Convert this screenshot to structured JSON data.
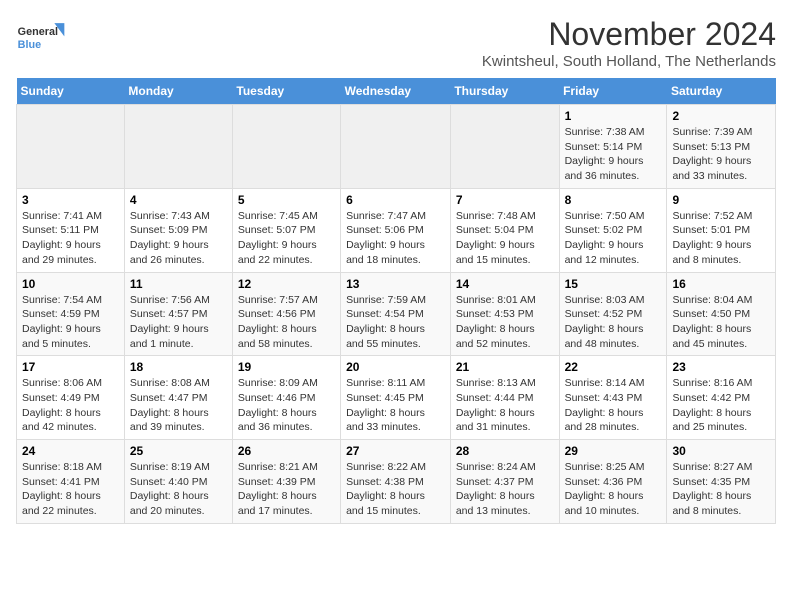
{
  "logo": {
    "line1": "General",
    "line2": "Blue"
  },
  "title": "November 2024",
  "location": "Kwintsheul, South Holland, The Netherlands",
  "headers": [
    "Sunday",
    "Monday",
    "Tuesday",
    "Wednesday",
    "Thursday",
    "Friday",
    "Saturday"
  ],
  "weeks": [
    [
      {
        "day": "",
        "info": ""
      },
      {
        "day": "",
        "info": ""
      },
      {
        "day": "",
        "info": ""
      },
      {
        "day": "",
        "info": ""
      },
      {
        "day": "",
        "info": ""
      },
      {
        "day": "1",
        "info": "Sunrise: 7:38 AM\nSunset: 5:14 PM\nDaylight: 9 hours and 36 minutes."
      },
      {
        "day": "2",
        "info": "Sunrise: 7:39 AM\nSunset: 5:13 PM\nDaylight: 9 hours and 33 minutes."
      }
    ],
    [
      {
        "day": "3",
        "info": "Sunrise: 7:41 AM\nSunset: 5:11 PM\nDaylight: 9 hours and 29 minutes."
      },
      {
        "day": "4",
        "info": "Sunrise: 7:43 AM\nSunset: 5:09 PM\nDaylight: 9 hours and 26 minutes."
      },
      {
        "day": "5",
        "info": "Sunrise: 7:45 AM\nSunset: 5:07 PM\nDaylight: 9 hours and 22 minutes."
      },
      {
        "day": "6",
        "info": "Sunrise: 7:47 AM\nSunset: 5:06 PM\nDaylight: 9 hours and 18 minutes."
      },
      {
        "day": "7",
        "info": "Sunrise: 7:48 AM\nSunset: 5:04 PM\nDaylight: 9 hours and 15 minutes."
      },
      {
        "day": "8",
        "info": "Sunrise: 7:50 AM\nSunset: 5:02 PM\nDaylight: 9 hours and 12 minutes."
      },
      {
        "day": "9",
        "info": "Sunrise: 7:52 AM\nSunset: 5:01 PM\nDaylight: 9 hours and 8 minutes."
      }
    ],
    [
      {
        "day": "10",
        "info": "Sunrise: 7:54 AM\nSunset: 4:59 PM\nDaylight: 9 hours and 5 minutes."
      },
      {
        "day": "11",
        "info": "Sunrise: 7:56 AM\nSunset: 4:57 PM\nDaylight: 9 hours and 1 minute."
      },
      {
        "day": "12",
        "info": "Sunrise: 7:57 AM\nSunset: 4:56 PM\nDaylight: 8 hours and 58 minutes."
      },
      {
        "day": "13",
        "info": "Sunrise: 7:59 AM\nSunset: 4:54 PM\nDaylight: 8 hours and 55 minutes."
      },
      {
        "day": "14",
        "info": "Sunrise: 8:01 AM\nSunset: 4:53 PM\nDaylight: 8 hours and 52 minutes."
      },
      {
        "day": "15",
        "info": "Sunrise: 8:03 AM\nSunset: 4:52 PM\nDaylight: 8 hours and 48 minutes."
      },
      {
        "day": "16",
        "info": "Sunrise: 8:04 AM\nSunset: 4:50 PM\nDaylight: 8 hours and 45 minutes."
      }
    ],
    [
      {
        "day": "17",
        "info": "Sunrise: 8:06 AM\nSunset: 4:49 PM\nDaylight: 8 hours and 42 minutes."
      },
      {
        "day": "18",
        "info": "Sunrise: 8:08 AM\nSunset: 4:47 PM\nDaylight: 8 hours and 39 minutes."
      },
      {
        "day": "19",
        "info": "Sunrise: 8:09 AM\nSunset: 4:46 PM\nDaylight: 8 hours and 36 minutes."
      },
      {
        "day": "20",
        "info": "Sunrise: 8:11 AM\nSunset: 4:45 PM\nDaylight: 8 hours and 33 minutes."
      },
      {
        "day": "21",
        "info": "Sunrise: 8:13 AM\nSunset: 4:44 PM\nDaylight: 8 hours and 31 minutes."
      },
      {
        "day": "22",
        "info": "Sunrise: 8:14 AM\nSunset: 4:43 PM\nDaylight: 8 hours and 28 minutes."
      },
      {
        "day": "23",
        "info": "Sunrise: 8:16 AM\nSunset: 4:42 PM\nDaylight: 8 hours and 25 minutes."
      }
    ],
    [
      {
        "day": "24",
        "info": "Sunrise: 8:18 AM\nSunset: 4:41 PM\nDaylight: 8 hours and 22 minutes."
      },
      {
        "day": "25",
        "info": "Sunrise: 8:19 AM\nSunset: 4:40 PM\nDaylight: 8 hours and 20 minutes."
      },
      {
        "day": "26",
        "info": "Sunrise: 8:21 AM\nSunset: 4:39 PM\nDaylight: 8 hours and 17 minutes."
      },
      {
        "day": "27",
        "info": "Sunrise: 8:22 AM\nSunset: 4:38 PM\nDaylight: 8 hours and 15 minutes."
      },
      {
        "day": "28",
        "info": "Sunrise: 8:24 AM\nSunset: 4:37 PM\nDaylight: 8 hours and 13 minutes."
      },
      {
        "day": "29",
        "info": "Sunrise: 8:25 AM\nSunset: 4:36 PM\nDaylight: 8 hours and 10 minutes."
      },
      {
        "day": "30",
        "info": "Sunrise: 8:27 AM\nSunset: 4:35 PM\nDaylight: 8 hours and 8 minutes."
      }
    ]
  ]
}
